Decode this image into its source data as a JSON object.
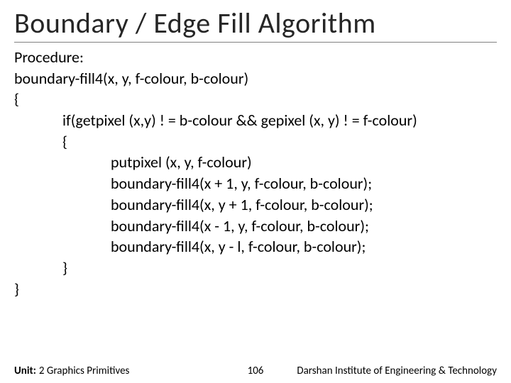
{
  "title": "Boundary / Edge Fill Algorithm",
  "body": {
    "l0": "Procedure:",
    "l1": "boundary-fill4(x, y, f-colour, b-colour)",
    "l2": "{",
    "l3": "if(getpixel (x,y) ! = b-colour && gepixel (x, y) ! = f-colour)",
    "l4": "{",
    "l5": "putpixel (x, y, f-colour)",
    "l6": "boundary-fill4(x + 1, y, f-colour, b-colour);",
    "l7": "boundary-fill4(x, y + 1, f-colour, b-colour);",
    "l8": "boundary-fill4(x - 1, y, f-colour, b-colour);",
    "l9": "boundary-fill4(x, y - l, f-colour, b-colour);",
    "l10": "}",
    "l11": "}"
  },
  "footer": {
    "unit_label": "Unit:",
    "unit_text": "2 Graphics Primitives",
    "page": "106",
    "institute": "Darshan Institute of Engineering & Technology"
  }
}
